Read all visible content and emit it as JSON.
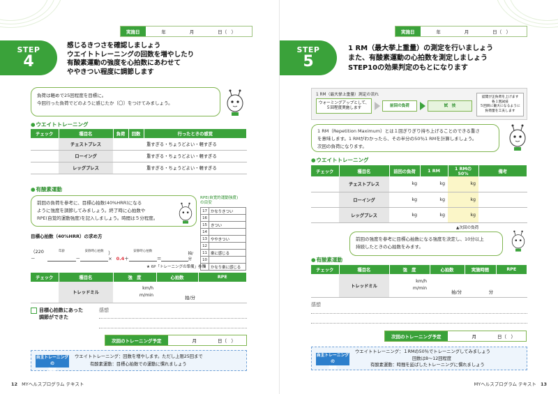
{
  "left": {
    "date_label": "実施日",
    "date_year": "年",
    "date_month": "月",
    "date_day": "日（　）",
    "step_word": "STEP",
    "step_num": "4",
    "title_lines": [
      "感じるきつさを確認しましょう",
      "ウエイトトレーニングの回数を増やしたり",
      "有酸素運動の強度を心拍数にあわせて",
      "ややきつい程度に調節します"
    ],
    "bubble1_lines": [
      "負荷は軽めで25回程度を目標に。",
      "今回行った負荷でどのように感じたか〔〇〕をつけてみましょう。"
    ],
    "weight_section": "ウエイトトレーニング",
    "weight_headers": [
      "チェック",
      "種目名",
      "負荷",
      "回数",
      "行ったときの感覚"
    ],
    "weight_rows": [
      {
        "name": "チェストプレス",
        "feel": "重すぎる・ちょうどよい・軽すぎる"
      },
      {
        "name": "ローイング",
        "feel": "重すぎる・ちょうどよい・軽すぎる"
      },
      {
        "name": "レッグプレス",
        "feel": "重すぎる・ちょうどよい・軽すぎる"
      }
    ],
    "aerobic_section": "有酸素運動",
    "bubble2_lines": [
      "前回の負荷を参考に、目標心拍数(40%HRR)になる",
      "ように強度を調節してみましょう。終了時に心拍数や",
      "RPE(自覚的運動強度)を記入しましょう。時間は５分程度。"
    ],
    "rpe_title_1": "RPE(自覚的運動強度)",
    "rpe_title_2": "の目安",
    "rpe_rows": [
      {
        "k": "17",
        "v": "かなりきつい"
      },
      {
        "k": "16",
        "v": ""
      },
      {
        "k": "15",
        "v": "きつい"
      },
      {
        "k": "14",
        "v": ""
      },
      {
        "k": "13",
        "v": "ややきつい"
      },
      {
        "k": "12",
        "v": ""
      },
      {
        "k": "11",
        "v": "楽に感じる"
      },
      {
        "k": "10",
        "v": ""
      },
      {
        "k": "9",
        "v": "かなり楽に感じる"
      }
    ],
    "formula_title": "目標心拍数（40%HRR）の求め方",
    "formula_open": "（220－",
    "formula_l1": "年齢",
    "formula_minus": "－",
    "formula_l2": "安静時心拍数",
    "formula_mid": "）×",
    "formula_coef": "0.4",
    "formula_plus": "＋",
    "formula_l3": "安静時心拍数",
    "formula_eq": "＝",
    "formula_unit": "拍/分",
    "formula_note": "★ 6P「トレーニングの準備」参照",
    "aero_headers": [
      "チェック",
      "種目名",
      "強　度",
      "心拍数",
      "RPE"
    ],
    "aero_row": {
      "name": "トレッドミル",
      "u1": "km/h",
      "u2": "m/min",
      "u3": "拍/分"
    },
    "check_label_1": "目標心拍数にあった",
    "check_label_2": "調節ができた",
    "impression": "感想",
    "next_label": "次回のトレーニング予定",
    "next_month": "月",
    "next_day": "日（　）",
    "assign_label_1": "自主トレーニングの",
    "assign_label_2": "課題",
    "assign_l1": "ウエイトトレーニング：回数を増やします。ただし上限25回まで",
    "assign_l2": "有酸素運動：目標心拍数での運動に慣れましょう",
    "footer_num": "12",
    "footer_text": "MYヘルスプログラム テキスト"
  },
  "right": {
    "date_label": "実施日",
    "date_year": "年",
    "date_month": "月",
    "date_day": "日（　）",
    "step_word": "STEP",
    "step_num": "5",
    "title_lines": [
      "1 RM（最大挙上重量）の測定を行いましょう",
      "また、有酸素運動の心拍数を測定しましょう",
      "STEP10の効果判定のもとになります"
    ],
    "flow_title": "1 RM（最大挙上重量）測定の流れ",
    "flow_warm_1": "ウォーミングアップとして、",
    "flow_warm_2": "５回程度実施します",
    "flow_prev": "前回の負荷",
    "flow_try": "試　技",
    "flow_note_1": "認開が正負荷を上げます",
    "flow_note_2": "各１回試技",
    "flow_note_3": "５回目に最大になるように",
    "flow_note_4": "負荷量を工夫します",
    "bubble1_lines": [
      "1 RM（Repetition Maximum）とは１回ぎりぎり持ち上げることのできる重さ",
      "を意味します。1 RMがわかったら、その半分の50％1 RMを計算しましょう。",
      "次回の負荷になります。"
    ],
    "weight_section": "ウエイトトレーニング",
    "weight_headers": [
      "チェック",
      "種目名",
      "前回の負荷",
      "1 RM",
      "1 RMの50%",
      "備考"
    ],
    "weight_rows": [
      {
        "name": "チェストプレス"
      },
      {
        "name": "ローイング"
      },
      {
        "name": "レッグプレス"
      }
    ],
    "kg": "kg",
    "next_load_note": "▲次回の負荷",
    "bubble2_lines": [
      "前回の強度を参考に目標心拍数になる強度を決定し、10分以上",
      "持続したときの心拍数をみます。"
    ],
    "aerobic_section": "有酸素運動",
    "aero_headers": [
      "チェック",
      "種目名",
      "強　度",
      "心拍数",
      "実施時間",
      "RPE"
    ],
    "aero_row": {
      "name": "トレッドミル",
      "u1": "km/h",
      "u2": "m/min",
      "u3": "拍/分",
      "u4": "分"
    },
    "impression": "感想",
    "next_label": "次回のトレーニング予定",
    "next_month": "月",
    "next_day": "日（　）",
    "assign_label_1": "自主トレーニングの",
    "assign_label_2": "課題",
    "assign_l1": "ウエイトトレーニング：１RMの50％でトレーニングしてみましょう",
    "assign_l2": "回数は8～12回程度",
    "assign_l3": "有酸素運動：時間を延ばしたトレーニングに慣れましょう",
    "footer_text": "MYヘルスプログラム テキスト",
    "footer_num": "13"
  }
}
